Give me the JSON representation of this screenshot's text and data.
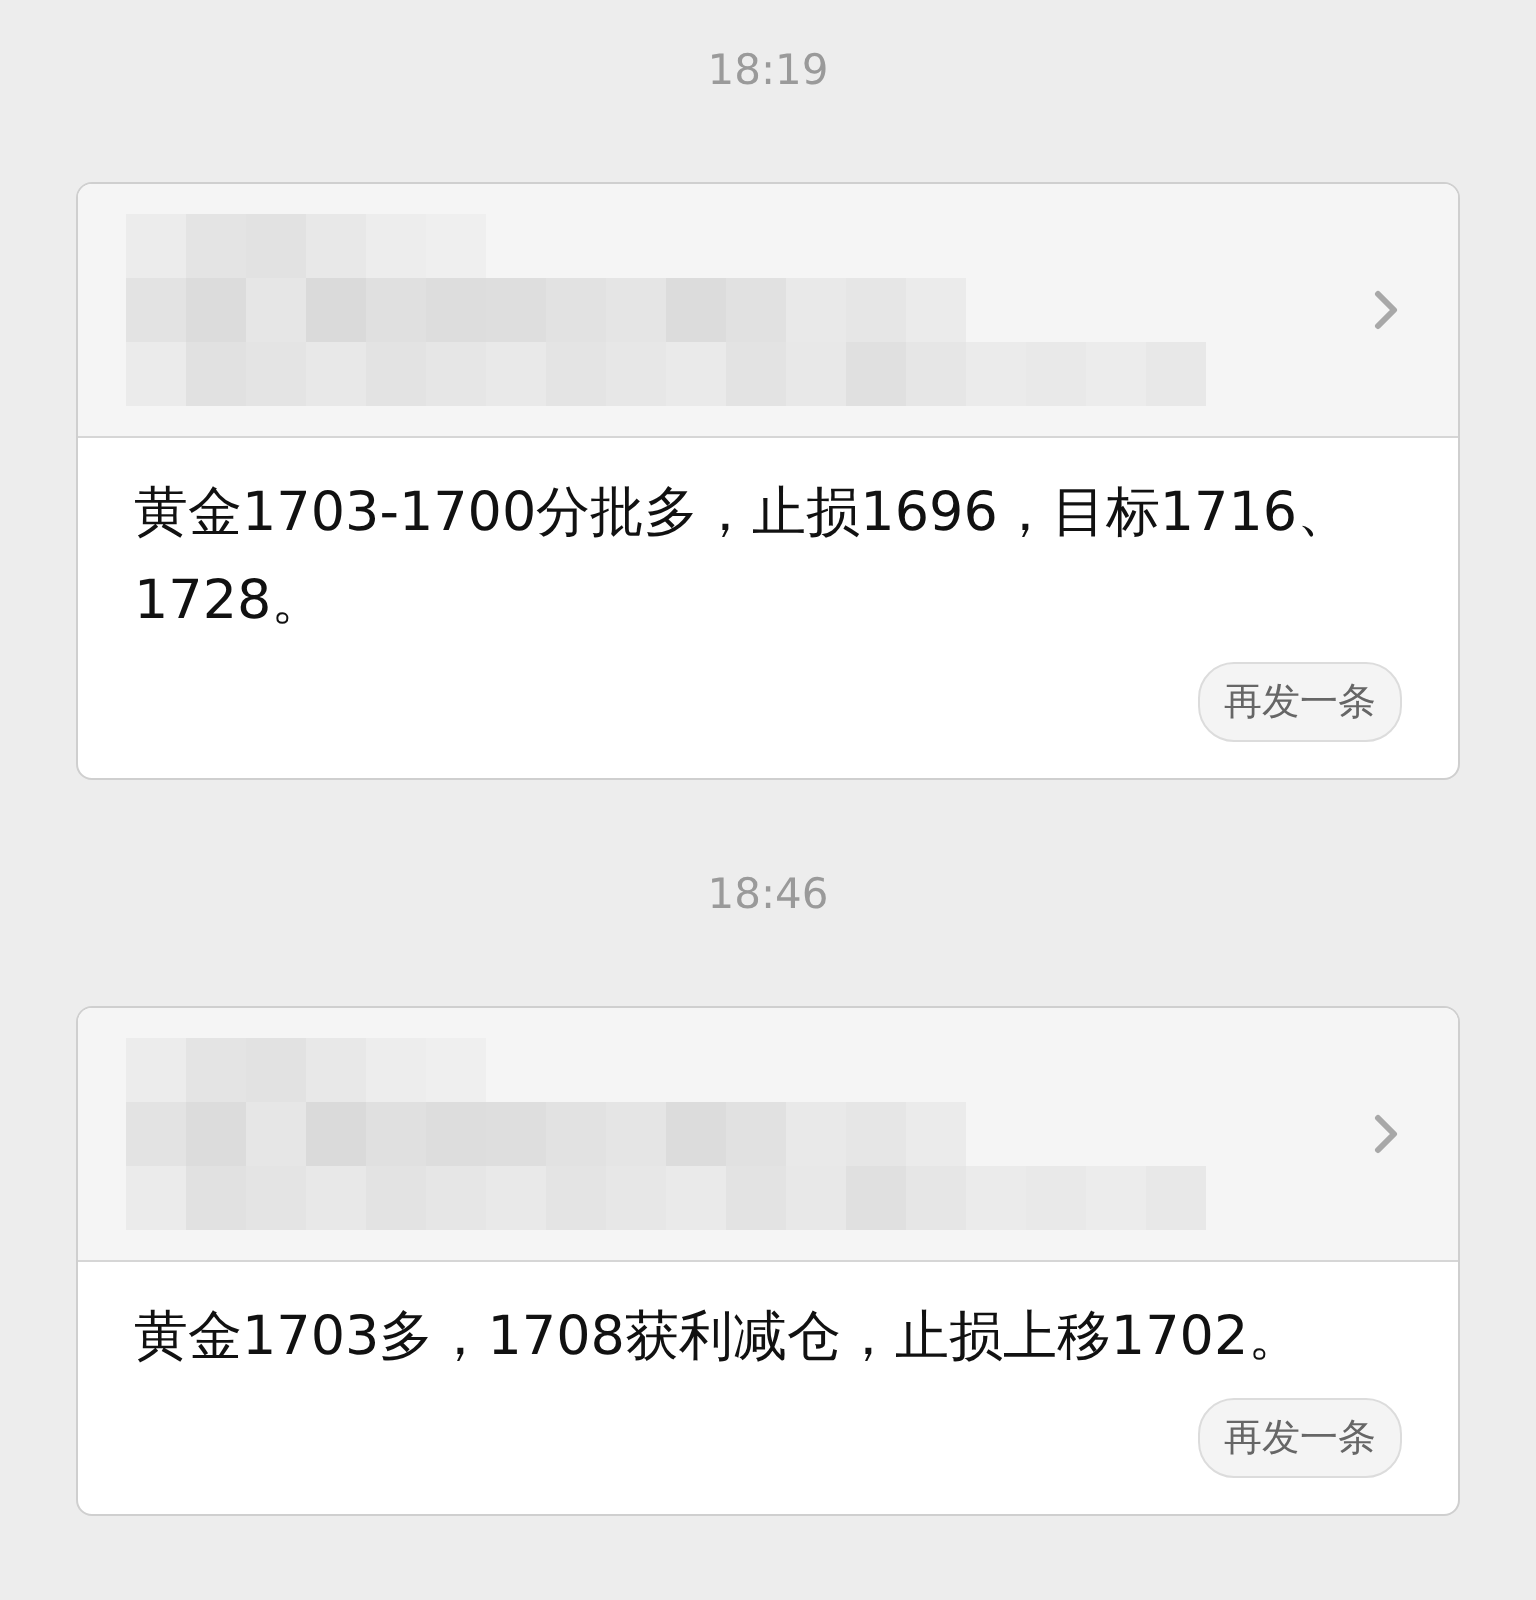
{
  "messages": [
    {
      "time": "18:19",
      "text": "黄金1703-1700分批多，止损1696，目标1716、1728。",
      "resend_button": "再发一条"
    },
    {
      "time": "18:46",
      "text": "黄金1703多，1708获利减仓，止损上移1702。",
      "resend_button": "再发一条"
    }
  ]
}
